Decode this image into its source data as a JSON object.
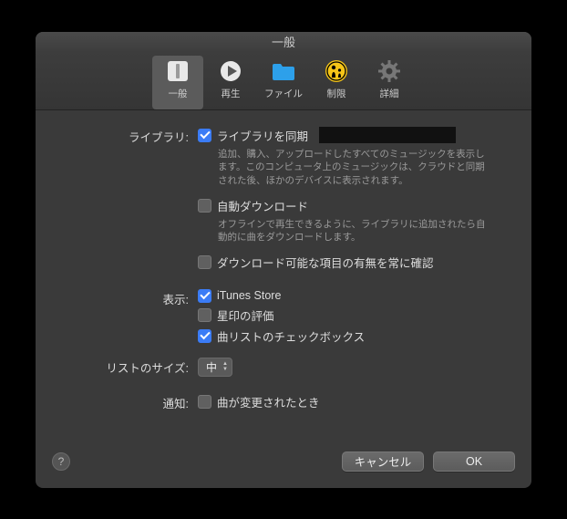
{
  "window": {
    "title": "一般"
  },
  "toolbar": {
    "items": [
      {
        "label": "一般"
      },
      {
        "label": "再生"
      },
      {
        "label": "ファイル"
      },
      {
        "label": "制限"
      },
      {
        "label": "詳細"
      }
    ]
  },
  "library": {
    "section_label": "ライブラリ:",
    "sync_label": "ライブラリを同期",
    "sync_desc": "追加、購入、アップロードしたすべてのミュージックを表示します。このコンピュータ上のミュージックは、クラウドと同期された後、ほかのデバイスに表示されます。",
    "autodl_label": "自動ダウンロード",
    "autodl_desc": "オフラインで再生できるように、ライブラリに追加されたら自動的に曲をダウンロードします。",
    "checkdl_label": "ダウンロード可能な項目の有無を常に確認"
  },
  "display": {
    "section_label": "表示:",
    "itunes_label": "iTunes Store",
    "star_label": "星印の評価",
    "checkbox_label": "曲リストのチェックボックス"
  },
  "listsize": {
    "section_label": "リストのサイズ:",
    "value": "中"
  },
  "notify": {
    "section_label": "通知:",
    "songchanged_label": "曲が変更されたとき"
  },
  "footer": {
    "help": "?",
    "cancel": "キャンセル",
    "ok": "OK"
  }
}
